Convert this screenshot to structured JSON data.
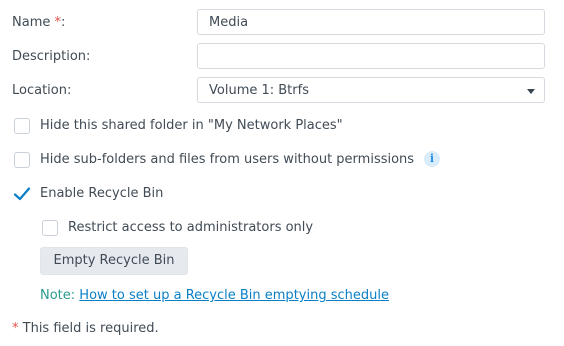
{
  "form": {
    "name": {
      "label": "Name",
      "required_mark": "*",
      "colon": ":",
      "value": "Media"
    },
    "description": {
      "label": "Description:",
      "value": ""
    },
    "location": {
      "label": "Location:",
      "value": "Volume 1:  Btrfs"
    }
  },
  "options": {
    "hide_network_places": {
      "label": "Hide this shared folder in \"My Network Places\"",
      "checked": false
    },
    "hide_subfolders": {
      "label": "Hide sub-folders and files from users without permissions",
      "checked": false,
      "info_icon": "i"
    },
    "enable_recycle_bin": {
      "label": "Enable Recycle Bin",
      "checked": true
    },
    "restrict_admin": {
      "label": "Restrict access to administrators only",
      "checked": false
    }
  },
  "empty_button": {
    "label": "Empty Recycle Bin"
  },
  "note": {
    "prefix": "Note:",
    "link": "How to set up a Recycle Bin emptying schedule"
  },
  "footer": {
    "required_mark": "*",
    "text": "This field is required."
  },
  "colors": {
    "accent": "#0a7fc8",
    "required": "#e2524c",
    "note": "#2a9a8e"
  }
}
